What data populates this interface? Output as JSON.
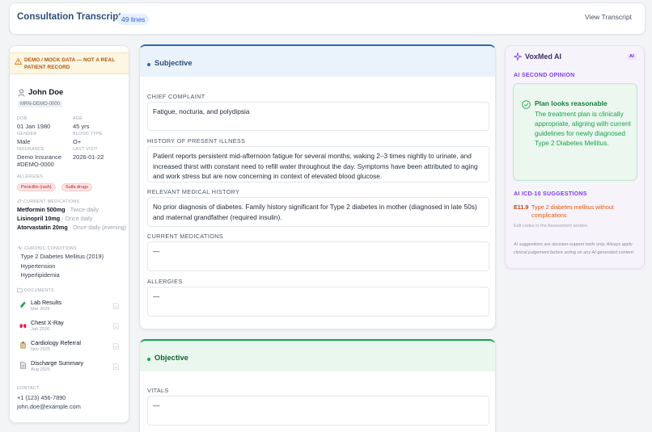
{
  "header": {
    "title": "Consultation Transcript",
    "lines_badge": "49 lines",
    "view_transcript": "View Transcript"
  },
  "patient": {
    "banner": "DEMO / MOCK DATA — NOT A REAL PATIENT RECORD",
    "name": "John Doe",
    "mrn": "MRN-DEMO-0000",
    "fields": {
      "dob_label": "DOB",
      "dob": "01 Jan 1980",
      "age_label": "AGE",
      "age": "45 yrs",
      "gender_label": "GENDER",
      "gender": "Male",
      "blood_label": "BLOOD TYPE",
      "blood": "O+",
      "insurance_label": "INSURANCE",
      "insurance": "Demo Insurance #DEMO-0000",
      "last_visit_label": "LAST VISIT",
      "last_visit": "2026-01-22"
    },
    "allergies_label": "ALLERGIES",
    "allergies": [
      "Penicillin (rash)",
      "Sulfa drugs"
    ],
    "meds_label": "CURRENT MEDICATIONS",
    "medications": [
      {
        "name": "Metformin 500mg",
        "freq": "· Twice daily"
      },
      {
        "name": "Lisinopril 10mg",
        "freq": "· Once daily"
      },
      {
        "name": "Atorvastatin 20mg",
        "freq": "· Once daily (evening)"
      }
    ],
    "conditions_label": "CHRONIC CONDITIONS",
    "conditions": [
      "Type 2 Diabetes Mellitus (2019)",
      "Hypertension",
      "Hyperlipidemia"
    ],
    "documents_label": "DOCUMENTS",
    "documents": [
      {
        "name": "Lab Results",
        "date": "Mar 2026",
        "icon": "test-tube-icon"
      },
      {
        "name": "Chest X-Ray",
        "date": "Jan 2026",
        "icon": "lungs-icon"
      },
      {
        "name": "Cardiology Referral",
        "date": "Nov 2025",
        "icon": "clipboard-icon"
      },
      {
        "name": "Discharge Summary",
        "date": "Aug 2025",
        "icon": "document-icon"
      }
    ],
    "contact_label": "CONTACT",
    "phone": "+1 (123) 456-7890",
    "email": "john.doe@example.com"
  },
  "soap": {
    "subjective": {
      "title": "Subjective",
      "chief_complaint_label": "CHIEF COMPLAINT",
      "chief_complaint": "Fatigue, nocturia, and polydipsia",
      "hpi_label": "HISTORY OF PRESENT ILLNESS",
      "hpi": "Patient reports persistent mid-afternoon fatigue for several months, waking 2–3 times nightly to urinate, and increased thirst with constant need to refill water throughout the day. Symptoms have been attributed to aging and work stress but are now concerning in context of elevated blood glucose.",
      "rmh_label": "RELEVANT MEDICAL HISTORY",
      "rmh": "No prior diagnosis of diabetes. Family history significant for Type 2 diabetes in mother (diagnosed in late 50s) and maternal grandfather (required insulin).",
      "meds_label": "CURRENT MEDICATIONS",
      "meds": "—",
      "allergies_label": "ALLERGIES",
      "allergies": "—"
    },
    "objective": {
      "title": "Objective",
      "vitals_label": "VITALS",
      "vitals": "—"
    }
  },
  "ai": {
    "title": "VoxMed AI",
    "badge": "AI",
    "second_opinion_label": "AI SECOND OPINION",
    "opinion_title": "Plan looks reasonable",
    "opinion_text": "The treatment plan is clinically appropriate, aligning with current guidelines for newly diagnosed Type 2 Diabetes Mellitus.",
    "icd_label": "AI ICD-10 SUGGESTIONS",
    "icd": [
      {
        "code": "E11.9",
        "desc": "Type 2 diabetes mellitus without complications"
      }
    ],
    "edit_note": "Edit codes in the Assessment section.",
    "disclaimer": "AI suggestions are decision-support tools only. Always apply clinical judgement before acting on any AI-generated content."
  },
  "colors": {
    "accent": "#2b4f7a",
    "subjective_head": "#eaf2fb",
    "objective_head": "#e9f7ef",
    "ai_purple": "#7c3aed"
  }
}
